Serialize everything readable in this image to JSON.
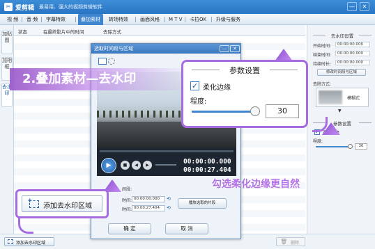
{
  "app": {
    "name": "爱剪辑",
    "slogan": "最易用、强大的视频剪辑软件",
    "win_min": "—",
    "win_close": "✕"
  },
  "menu": [
    {
      "label": "视  频"
    },
    {
      "label": "音  频"
    },
    {
      "label": "字幕特效"
    },
    {
      "label": "叠加素材",
      "active": true
    },
    {
      "label": "转场特效"
    },
    {
      "label": "画面风格"
    },
    {
      "label": "M T V"
    },
    {
      "label": "卡拉OK"
    },
    {
      "label": "升级与服务"
    }
  ],
  "left_tabs": [
    {
      "label": "加贴图"
    },
    {
      "label": "加相框"
    },
    {
      "label": "去水印",
      "active": true
    }
  ],
  "list_columns": [
    "状态",
    "在最终影片中的时间",
    "去除方式"
  ],
  "right_panel": {
    "section1": "去水印设置",
    "start_label": "开始时间:",
    "start_value": "00:00:00.000",
    "end_label": "结束时间:",
    "end_value": "00:00:00.000",
    "duration_label": "持续时长:",
    "duration_value": "00:00:00.000",
    "modify_button": "修改时间段与区域",
    "method_label": "去除方式:",
    "method_value": "模糊式",
    "section2": "参数设置",
    "soft_edge_label": "柔化边缘",
    "degree_label": "程度:",
    "degree_value": "30"
  },
  "bottom": {
    "add_button": "添加去水印区域",
    "delete_button": "删除"
  },
  "dialog": {
    "title": "选取时间段与区域",
    "min": "—",
    "close": "✕",
    "time_current": "00:00:00.000",
    "time_total": "00:00:27.404",
    "range_label": "间段:",
    "start_label": "时间:",
    "start_value": "00:00:00.000",
    "end_label": "时间:",
    "end_value": "00:00:27.404",
    "preview_button": "播放选取的片段",
    "ok_button": "确  定",
    "cancel_button": "取  消"
  },
  "overlay": {
    "banner": "2.叠加素材—去水印",
    "popup_title": "参数设置",
    "popup_checkbox": "柔化边缘",
    "popup_degree_label": "程度:",
    "popup_degree_value": "30",
    "add_label": "添加去水印区域",
    "tip": "勾选柔化边缘更自然"
  },
  "colors": {
    "accent": "#3f86cf",
    "highlight": "#a66ce0"
  }
}
